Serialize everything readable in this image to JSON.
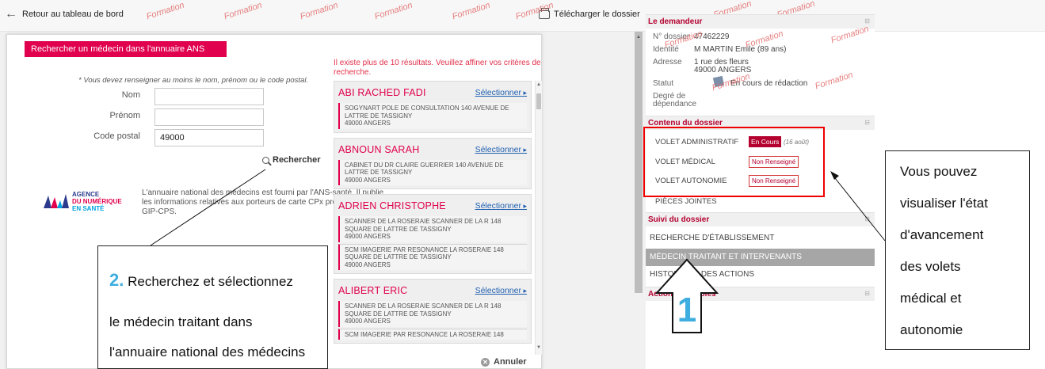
{
  "topbar": {
    "back_label": "Retour au tableau de bord",
    "download_label": "Télécharger le dossier",
    "watermark": "Formation"
  },
  "modal": {
    "title": "Rechercher un médecin dans l'annuaire ANS",
    "required_note": "* Vous devez renseigner au moins le nom, prénom ou le code postal.",
    "fields": {
      "nom_label": "Nom",
      "nom_value": "",
      "prenom_label": "Prénom",
      "prenom_value": "",
      "code_postal_label": "Code postal",
      "code_postal_value": "49000"
    },
    "search_label": "Rechercher",
    "logo": {
      "line1": "AGENCE",
      "line2": "DU NUMÉRIQUE",
      "line3": "EN SANTÉ"
    },
    "ans_description": "L'annuaire national des médecins est fourni par l'ANS-santé. Il publie les informations relatives aux porteurs de carte CPx produites par le GIP-CPS.",
    "results_message": "Il existe plus de 10 résultats. Veuillez affiner vos critères de recherche.",
    "select_label": "Sélectionner",
    "cancel_label": "Annuler",
    "results": [
      {
        "name": "ABI RACHED  FADI",
        "addresses": [
          {
            "line1": "SOGYNART POLE DE CONSULTATION 140 AVENUE DE LATTRE DE TASSIGNY",
            "line2": "49000  ANGERS"
          }
        ]
      },
      {
        "name": "ABNOUN  SARAH",
        "addresses": [
          {
            "line1": "CABINET DU DR CLAIRE GUERRIER 140 AVENUE DE LATTRE DE TASSIGNY",
            "line2": "49000  ANGERS"
          }
        ]
      },
      {
        "name": "ADRIEN  CHRISTOPHE",
        "addresses": [
          {
            "line1": "SCANNER DE LA ROSERAIE SCANNER DE LA R 148 SQUARE DE LATTRE DE TASSIGNY",
            "line2": "49000  ANGERS"
          },
          {
            "line1": "SCM IMAGERIE PAR RESONANCE LA ROSERAIE 148 SQUARE DE LATTRE DE TASSIGNY",
            "line2": "49000  ANGERS"
          }
        ]
      },
      {
        "name": "ALIBERT  ERIC",
        "addresses": [
          {
            "line1": "SCANNER DE LA ROSERAIE SCANNER DE LA R 148 SQUARE DE LATTRE DE TASSIGNY",
            "line2": "49000  ANGERS"
          },
          {
            "line1": "SCM IMAGERIE PAR RESONANCE LA ROSERAIE 148",
            "line2": ""
          }
        ]
      }
    ]
  },
  "demandeur": {
    "title": "Le demandeur",
    "dossier_label": "N° dossier",
    "dossier_value": "47462229",
    "identite_label": "Identité",
    "identite_value": "M MARTIN Emile (89 ans)",
    "adresse_label": "Adresse",
    "adresse_line1": "1 rue des fleurs",
    "adresse_line2": "49000 ANGERS",
    "statut_label": "Statut",
    "statut_value": "En cours de rédaction",
    "degre_label_1": "Degré de",
    "degre_label_2": "dépendance"
  },
  "contenu": {
    "title": "Contenu du dossier",
    "volets": [
      {
        "label": "VOLET ADMINISTRATIF",
        "status": "En Cours",
        "date": "(16 août)"
      },
      {
        "label": "VOLET MÉDICAL",
        "status": "Non Renseigné"
      },
      {
        "label": "VOLET AUTONOMIE",
        "status": "Non Renseigné"
      }
    ],
    "pieces_jointes": "PIÈCES JOINTES"
  },
  "suivi": {
    "title": "Suivi du dossier",
    "items": [
      "RECHERCHE D'ÉTABLISSEMENT",
      "MÉDECIN TRAITANT ET INTERVENANTS",
      "HISTORIQUE DES ACTIONS"
    ],
    "actions_title": "Actions possibles"
  },
  "annotations": {
    "step_number": "2.",
    "step_line1": "Recherchez et sélectionnez",
    "step_line2": "le médecin traitant dans",
    "step_line3": "l'annuaire national des médecins",
    "arrow_number": "1",
    "right_lines": [
      "Vous pouvez",
      "visualiser l'état",
      "d'avancement",
      "des volets",
      "médical et",
      "autonomie"
    ]
  },
  "colors": {
    "accent": "#e0004d",
    "dark_red": "#b4002f",
    "link": "#1f5fb0",
    "callout_number": "#3eaee0"
  }
}
